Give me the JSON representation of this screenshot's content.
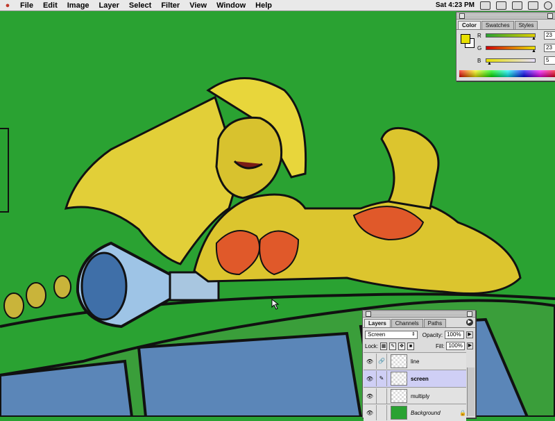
{
  "menubar": {
    "apple": "",
    "items": [
      "File",
      "Edit",
      "Image",
      "Layer",
      "Select",
      "Filter",
      "View",
      "Window",
      "Help"
    ],
    "clock": "Sat 4:23 PM"
  },
  "color_panel": {
    "tabs": [
      "Color",
      "Swatches",
      "Styles"
    ],
    "channels": [
      {
        "label": "R",
        "value": "23"
      },
      {
        "label": "G",
        "value": "23"
      },
      {
        "label": "B",
        "value": "5"
      }
    ],
    "foreground_color": "#e8e000"
  },
  "layers_panel": {
    "tabs": [
      "Layers",
      "Channels",
      "Paths"
    ],
    "blend_mode": "Screen",
    "opacity_label": "Opacity:",
    "opacity_value": "100%",
    "lock_label": "Lock:",
    "fill_label": "Fill:",
    "fill_value": "100%",
    "layers": [
      {
        "name": "line"
      },
      {
        "name": "screen"
      },
      {
        "name": "multiply"
      },
      {
        "name": "Background"
      }
    ]
  },
  "colors": {
    "canvas_background": "#2aa232",
    "accent_selected": "#cfcff5"
  }
}
